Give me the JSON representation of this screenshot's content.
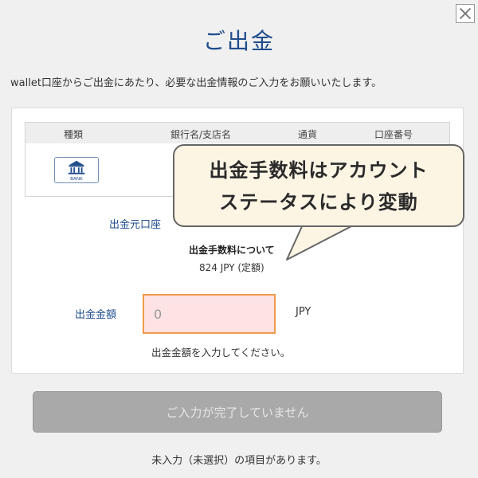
{
  "dialog": {
    "title": "ご出金",
    "close_label": "close",
    "intro": "wallet口座からご出金にあたり、必要な出金情報のご入力をお願いいたします。"
  },
  "table": {
    "headers": [
      "種類",
      "銀行名/支店名",
      "通貨",
      "口座番号"
    ],
    "row": {
      "type_icon": "bank-icon",
      "icon_text": "BANK"
    }
  },
  "form": {
    "source_label": "出金元口座",
    "fee_title": "出金手数料について",
    "fee_amount": "824 JPY (定額)",
    "amount_label": "出金金額",
    "amount_value": "",
    "amount_placeholder": "0",
    "unit": "JPY",
    "hint": "出金金額を入力してください。"
  },
  "submit": {
    "label": "ご入力が完了していません"
  },
  "footer": {
    "missing_notice": "未入力（未選択）の項目があります。"
  },
  "callout": {
    "line1": "出金手数料はアカウント",
    "line2": "ステータスにより変動"
  },
  "colors": {
    "accent": "#1f4d8c",
    "input_bg": "#fde3e3",
    "input_border": "#ef9b4a",
    "disabled_button": "#a9a9a9",
    "callout_bg": "#fdf5e4"
  }
}
